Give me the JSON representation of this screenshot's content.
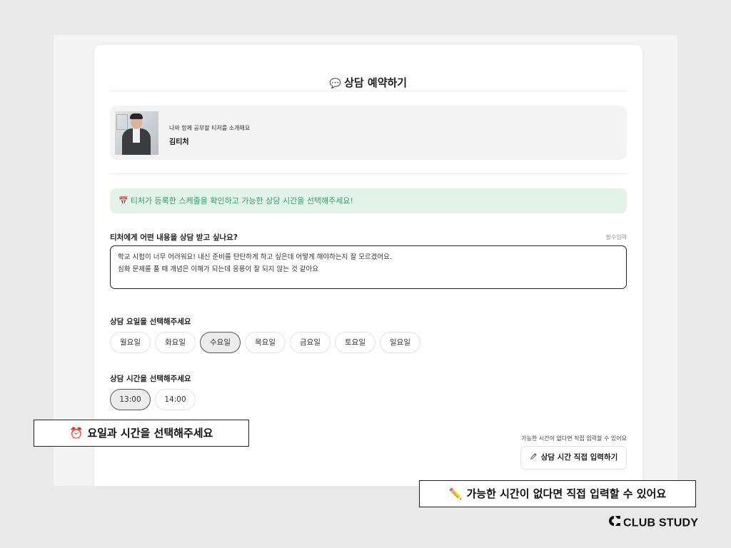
{
  "page": {
    "title": "상담 예약하기",
    "title_icon": "chat-bubble-icon"
  },
  "teacher": {
    "intro": "나와 함께 공부할 티처를 소개해요",
    "name": "김티처"
  },
  "notice": {
    "text": "티처가 등록한 스케줄을 확인하고 가능한 상담 시간을 선택해주세요!",
    "icon": "calendar-icon",
    "bg_color": "#e4f3ea",
    "text_color": "#3a9a66"
  },
  "question": {
    "label": "티처에게 어떤 내용을 상담 받고 싶나요?",
    "required": "필수입력",
    "lines": [
      "학교 시험이 너무 어려워요! 내신 준비를 탄탄하게 하고 싶은데 어떻게 해야하는지 잘 모르겠어요.",
      "심화 문제를 풀 때 개념은 이해가 되는데 응용이 잘 되지 않는 것 같아요"
    ]
  },
  "days": {
    "label": "상담 요일을 선택해주세요",
    "selected": "수요일",
    "options": [
      "월요일",
      "화요일",
      "수요일",
      "목요일",
      "금요일",
      "토요일",
      "일요일"
    ]
  },
  "times": {
    "label": "상담 시간을 선택해주세요",
    "selected": "13:00",
    "options": [
      "13:00",
      "14:00"
    ]
  },
  "direct": {
    "hint": "가능한 시간이 없다면 직접 입력할 수 있어요",
    "button": "상담 시간 직접 입력하기",
    "icon": "pencil-icon"
  },
  "callouts": {
    "select": "요일과 시간을 선택해주세요",
    "select_icon": "alarm-clock-icon",
    "direct": "가능한 시간이 없다면 직접 입력할 수 있어요",
    "direct_icon": "pencil-icon"
  },
  "brand": {
    "name": "CLUB STUDY"
  }
}
